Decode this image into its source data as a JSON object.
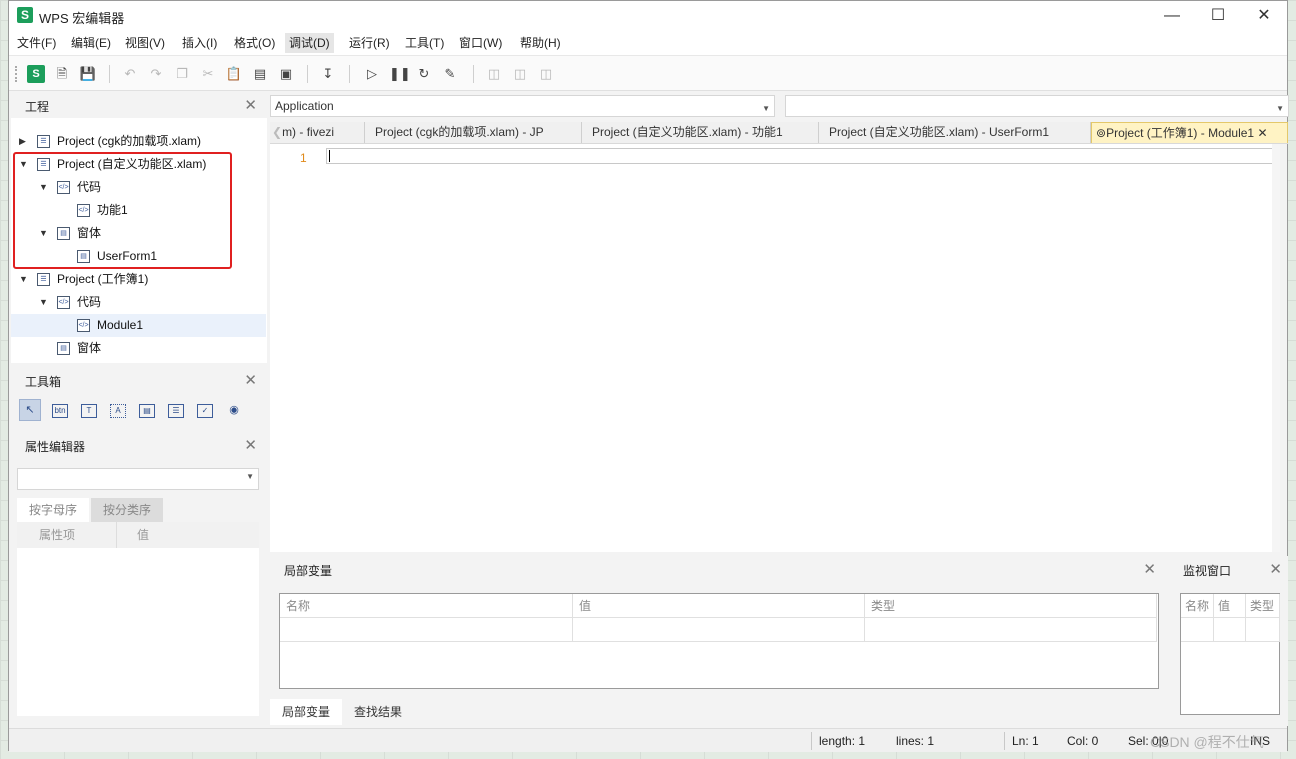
{
  "window": {
    "app_icon": "S",
    "title": "WPS 宏编辑器",
    "controls": [
      "minimize-icon",
      "maximize-icon",
      "close-icon"
    ]
  },
  "menu": [
    "文件(F)",
    "编辑(E)",
    "视图(V)",
    "插入(I)",
    "格式(O)",
    "调试(D)",
    "运行(R)",
    "工具(T)",
    "窗口(W)",
    "帮助(H)"
  ],
  "menu_active": "调试(D)",
  "toolbar_logo": "S",
  "project_panel": {
    "title": "工程",
    "tree": [
      {
        "label": "Project (cgk的加载项.xlam)",
        "expanded": false
      },
      {
        "label": "Project (自定义功能区.xlam)",
        "expanded": true
      },
      {
        "label": "代码"
      },
      {
        "label": "功能1"
      },
      {
        "label": "窗体"
      },
      {
        "label": "UserForm1"
      },
      {
        "label": "Project (工作簿1)",
        "expanded": true
      },
      {
        "label": "代码"
      },
      {
        "label": "Module1",
        "selected": true
      },
      {
        "label": "窗体"
      }
    ]
  },
  "toolbox_panel": {
    "title": "工具箱",
    "button_text": "btn"
  },
  "property_panel": {
    "title": "属性编辑器",
    "tabs": [
      "按字母序",
      "按分类序"
    ],
    "columns": [
      "属性项",
      "值"
    ]
  },
  "editor": {
    "object_combo": "Application",
    "procedure_combo": "",
    "tabs": [
      "m) - fivezi",
      "Project (cgk的加载项.xlam) - JP",
      "Project (自定义功能区.xlam) - 功能1",
      "Project (自定义功能区.xlam) - UserForm1",
      "Project (工作簿1) - Module1"
    ],
    "active_tab": "Project (工作簿1) - Module1",
    "line_number": "1"
  },
  "locals_panel": {
    "title": "局部变量",
    "columns": [
      "名称",
      "值",
      "类型"
    ]
  },
  "watch_panel": {
    "title": "监视窗口",
    "columns": [
      "名称",
      "值",
      "类型"
    ]
  },
  "bottom_tabs": [
    "局部变量",
    "查找结果"
  ],
  "status": {
    "length": "length: 1",
    "lines": "lines: 1",
    "ln": "Ln: 1",
    "col": "Col: 0",
    "sel": "Sel: 0|0",
    "mode": "INS"
  },
  "watermark": "CSDN @程不仕气"
}
